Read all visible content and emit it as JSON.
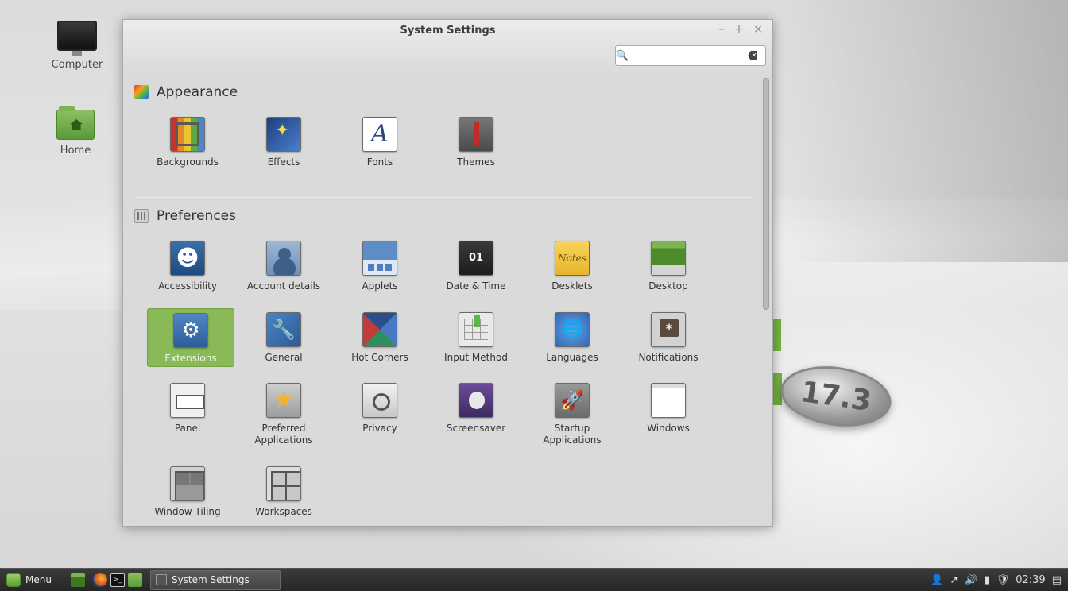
{
  "desktop": {
    "icons": [
      {
        "label": "Computer"
      },
      {
        "label": "Home"
      }
    ],
    "badge_text": "17.3"
  },
  "window": {
    "title": "System Settings",
    "controls": {
      "minimize": "–",
      "maximize": "+",
      "close": "×"
    },
    "search": {
      "value": "",
      "placeholder": ""
    }
  },
  "sections": [
    {
      "title": "Appearance",
      "items": [
        {
          "label": "Backgrounds"
        },
        {
          "label": "Effects"
        },
        {
          "label": "Fonts",
          "glyph": "A"
        },
        {
          "label": "Themes"
        }
      ]
    },
    {
      "title": "Preferences",
      "items": [
        {
          "label": "Accessibility"
        },
        {
          "label": "Account details"
        },
        {
          "label": "Applets"
        },
        {
          "label": "Date & Time",
          "glyph": "01"
        },
        {
          "label": "Desklets",
          "glyph": "Notes"
        },
        {
          "label": "Desktop"
        },
        {
          "label": "Extensions"
        },
        {
          "label": "General"
        },
        {
          "label": "Hot Corners"
        },
        {
          "label": "Input Method"
        },
        {
          "label": "Languages"
        },
        {
          "label": "Notifications"
        },
        {
          "label": "Panel"
        },
        {
          "label": "Preferred Applications"
        },
        {
          "label": "Privacy"
        },
        {
          "label": "Screensaver"
        },
        {
          "label": "Startup Applications"
        },
        {
          "label": "Windows"
        },
        {
          "label": "Window Tiling"
        },
        {
          "label": "Workspaces"
        }
      ]
    }
  ],
  "selected_item": "Extensions",
  "taskbar": {
    "menu_label": "Menu",
    "task_label": "System Settings",
    "clock": "02:39"
  },
  "colors": {
    "accent": "#8aba58",
    "taskbar": "#2f2f2f",
    "window_bg": "#dadada"
  }
}
